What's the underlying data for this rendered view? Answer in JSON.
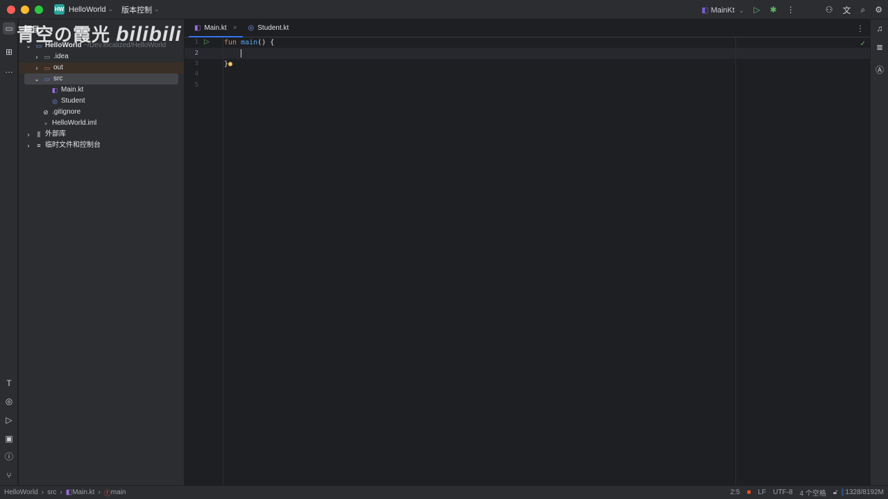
{
  "titlebar": {
    "project": "HelloWorld",
    "project_badge": "HW",
    "vcs": "版本控制",
    "run_config": "MainKt"
  },
  "project_panel": {
    "title": "项目",
    "root": "HelloWorld",
    "root_path": "~/Dev.localized/HelloWorld",
    "items": [
      {
        "label": ".idea"
      },
      {
        "label": "out"
      },
      {
        "label": "src"
      },
      {
        "label": "Main.kt"
      },
      {
        "label": "Student"
      },
      {
        "label": ".gitignore"
      },
      {
        "label": "HelloWorld.iml"
      },
      {
        "label": "外部库"
      },
      {
        "label": "临时文件和控制台"
      }
    ]
  },
  "editor": {
    "tabs": [
      {
        "label": "Main.kt"
      },
      {
        "label": "Student.kt"
      }
    ],
    "line_numbers": [
      "1",
      "2",
      "3",
      "4",
      "5"
    ],
    "code": {
      "kw": "fun",
      "fn": "main",
      "rest": "() {",
      "close": "}"
    }
  },
  "status": {
    "crumbs": [
      "HelloWorld",
      "src",
      "Main.kt",
      "main"
    ],
    "position": "2:5",
    "line_sep": "LF",
    "encoding": "UTF-8",
    "indent": "4 个空格",
    "memory": "1328/8192M"
  },
  "watermark": "青空の霞光 bilibili",
  "colors": {
    "accent": "#3574f0",
    "keyword": "#cf8e6d",
    "function": "#56a8f5",
    "run": "#5fb865"
  }
}
